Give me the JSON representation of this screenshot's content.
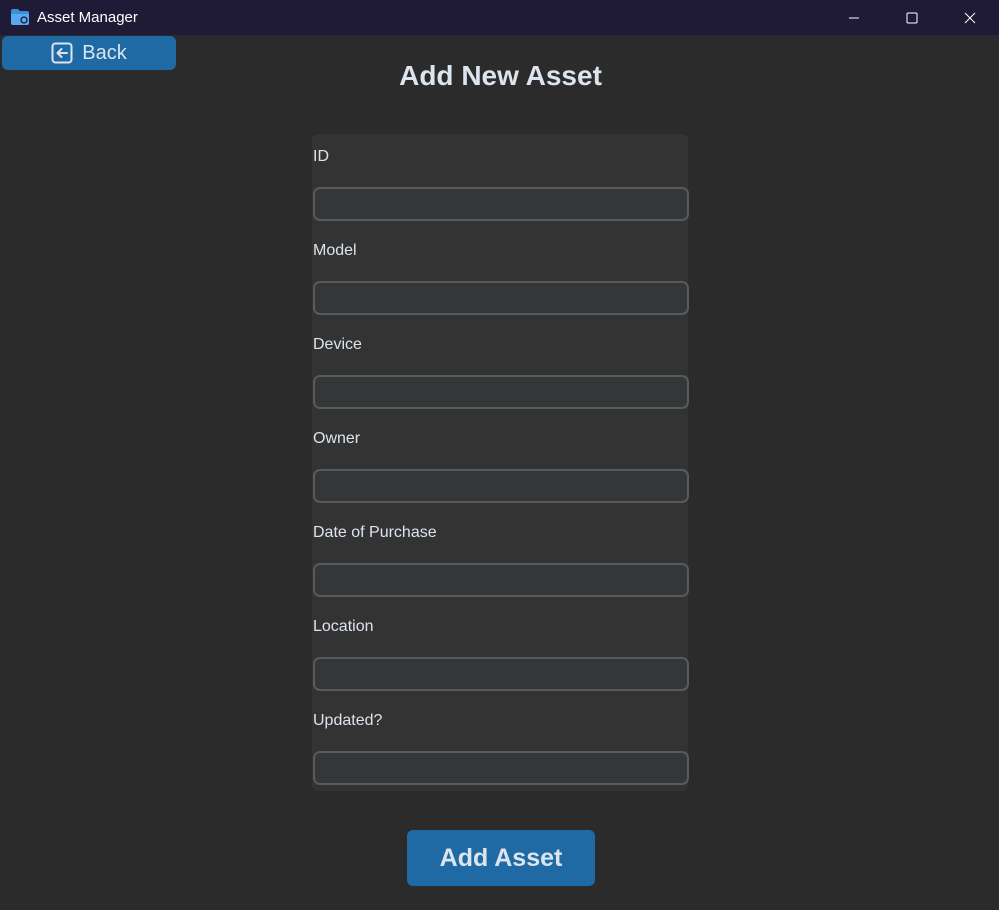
{
  "window": {
    "title": "Asset Manager",
    "titlebar_color": "#1f1b36",
    "background_color": "#2b2b2b"
  },
  "back_button": {
    "label": "Back",
    "icon": "arrow-left-box-icon",
    "color": "#1f6aa5"
  },
  "page": {
    "title": "Add New Asset"
  },
  "form": {
    "fields": [
      {
        "label": "ID",
        "value": ""
      },
      {
        "label": "Model",
        "value": ""
      },
      {
        "label": "Device",
        "value": ""
      },
      {
        "label": "Owner",
        "value": ""
      },
      {
        "label": "Date of Purchase",
        "value": ""
      },
      {
        "label": "Location",
        "value": ""
      },
      {
        "label": "Updated?",
        "value": ""
      }
    ]
  },
  "submit_button": {
    "label": "Add Asset",
    "color": "#1f6aa5"
  }
}
